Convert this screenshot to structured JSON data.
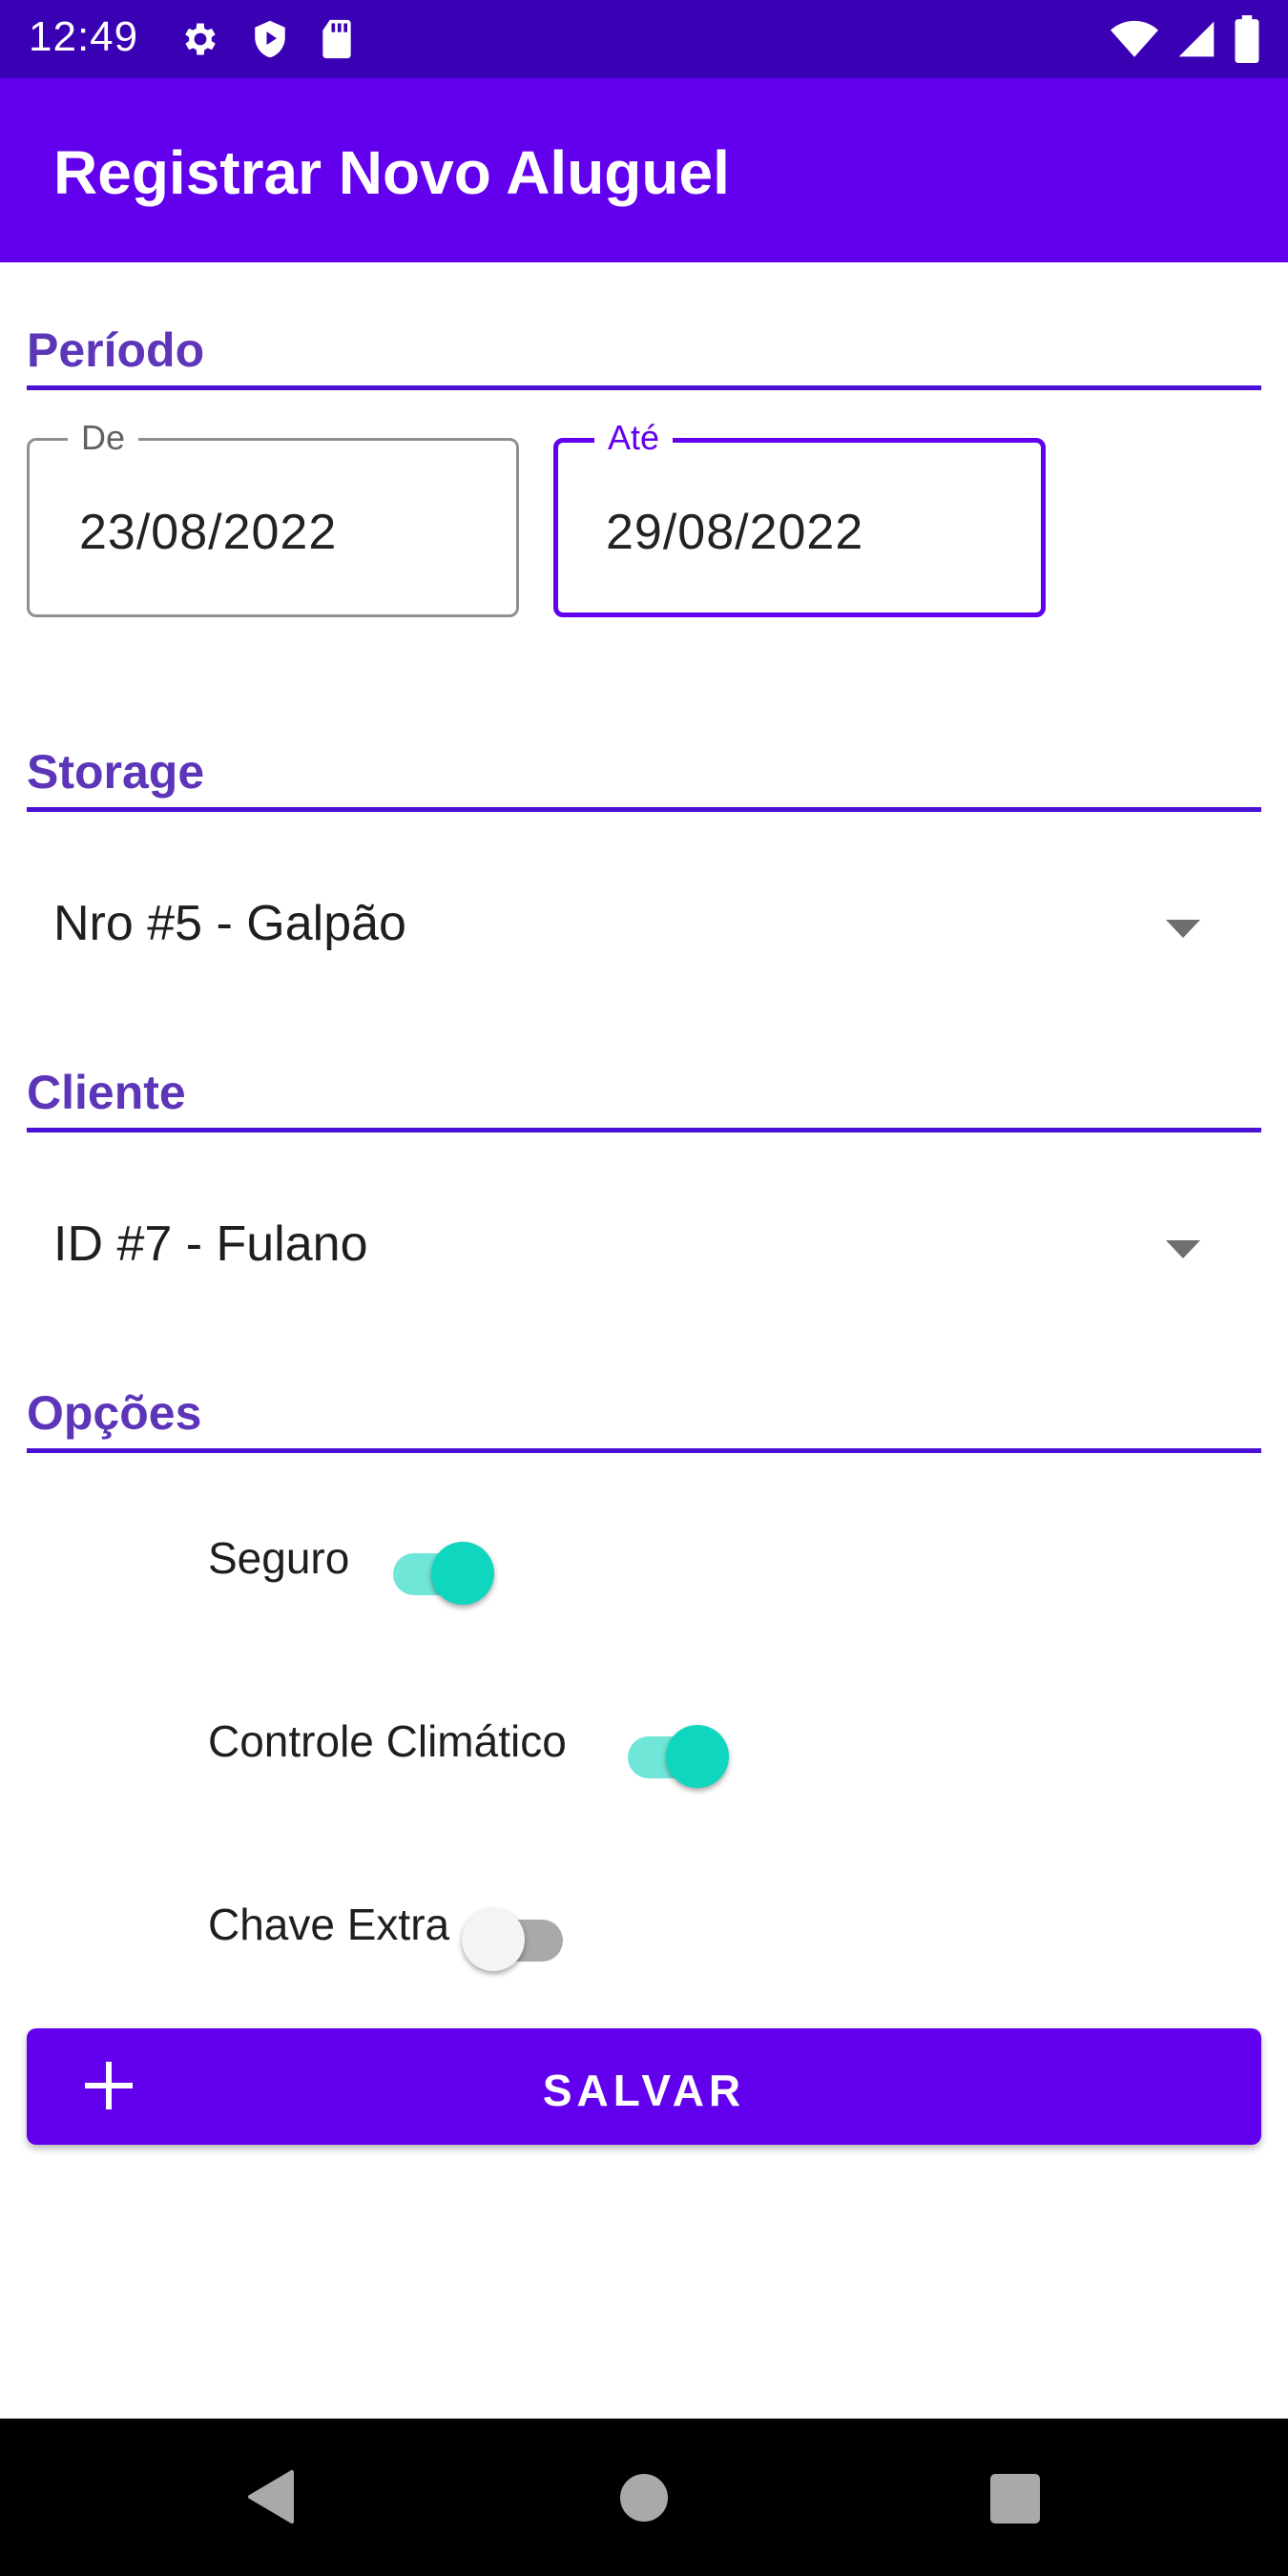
{
  "status_bar": {
    "time": "12:49",
    "left_icons": [
      "settings-gear-icon",
      "shield-play-icon",
      "sd-card-icon"
    ],
    "right_icons": [
      "wifi-icon",
      "cell-signal-icon",
      "battery-icon"
    ]
  },
  "app_bar": {
    "title": "Registrar Novo Aluguel"
  },
  "periodo": {
    "heading": "Período",
    "from_label": "De",
    "from_value": "23/08/2022",
    "to_label": "Até",
    "to_value": "29/08/2022"
  },
  "storage": {
    "heading": "Storage",
    "selected": "Nro #5 - Galpão"
  },
  "cliente": {
    "heading": "Cliente",
    "selected": "ID #7 - Fulano"
  },
  "opcoes": {
    "heading": "Opções",
    "switches": [
      {
        "label": "Seguro",
        "checked": true
      },
      {
        "label": "Controle Climático",
        "checked": true
      },
      {
        "label": "Chave Extra",
        "checked": false
      }
    ]
  },
  "save_button": {
    "label": "SALVAR",
    "icon": "plus-icon"
  },
  "nav_bar": {
    "icons": [
      "back-icon",
      "home-icon",
      "recents-icon"
    ]
  },
  "colors": {
    "status_bar": "#3a00b4",
    "primary": "#6200ee",
    "heading_text": "#5c35b8",
    "switch_on_thumb": "#0fd6be",
    "switch_on_track": "#6fe6d8",
    "switch_off_thumb": "#f4f4f4",
    "switch_off_track": "#a9a9a9"
  }
}
